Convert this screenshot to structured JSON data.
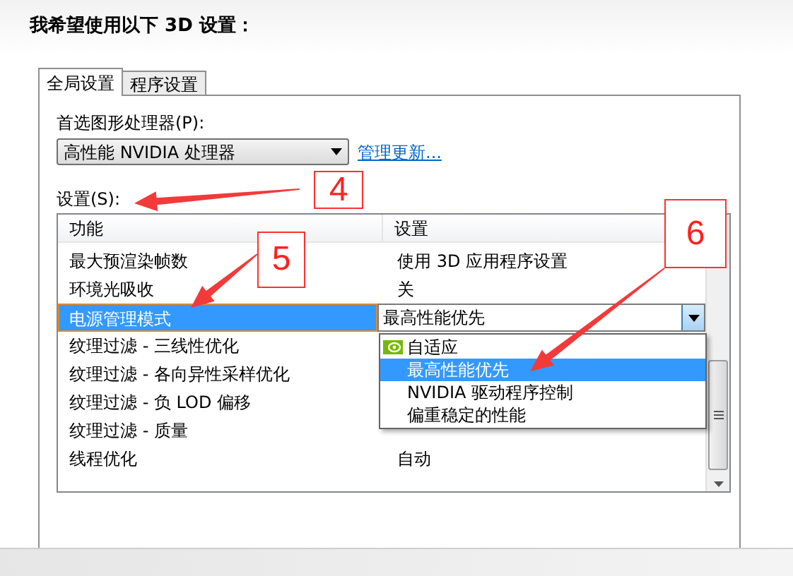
{
  "heading": "我希望使用以下 3D 设置：",
  "tabs": [
    {
      "label": "全局设置",
      "selected": true
    },
    {
      "label": "程序设置",
      "selected": false
    }
  ],
  "preferred_gpu": {
    "label": "首选图形处理器(P):",
    "value": "高性能 NVIDIA 处理器"
  },
  "manage_link": "管理更新...",
  "settings_label": "设置(S):",
  "table": {
    "columns": [
      "功能",
      "设置"
    ],
    "rows": [
      {
        "feature": "最大预渲染帧数",
        "setting": "使用 3D 应用程序设置",
        "selected": false
      },
      {
        "feature": "环境光吸收",
        "setting": "关",
        "selected": false
      },
      {
        "feature": "电源管理模式",
        "setting": "最高性能优先",
        "selected": true
      },
      {
        "feature": "纹理过滤 - 三线性优化",
        "selected": false
      },
      {
        "feature": "纹理过滤 - 各向异性采样优化",
        "selected": false
      },
      {
        "feature": "纹理过滤 - 负 LOD 偏移",
        "selected": false
      },
      {
        "feature": "纹理过滤 - 质量",
        "selected": false
      },
      {
        "feature": "线程优化",
        "setting": "自动",
        "selected": false
      }
    ]
  },
  "dropdown_options": [
    {
      "label": "自适应",
      "kind": "nvidia",
      "selected": false
    },
    {
      "label": "最高性能优先",
      "kind": "plain",
      "selected": true
    },
    {
      "label": "NVIDIA 驱动程序控制",
      "kind": "plain",
      "selected": false
    },
    {
      "label": "偏重稳定的性能",
      "kind": "plain",
      "selected": false
    }
  ],
  "annotations": [
    {
      "label": "4"
    },
    {
      "label": "5"
    },
    {
      "label": "6"
    }
  ]
}
